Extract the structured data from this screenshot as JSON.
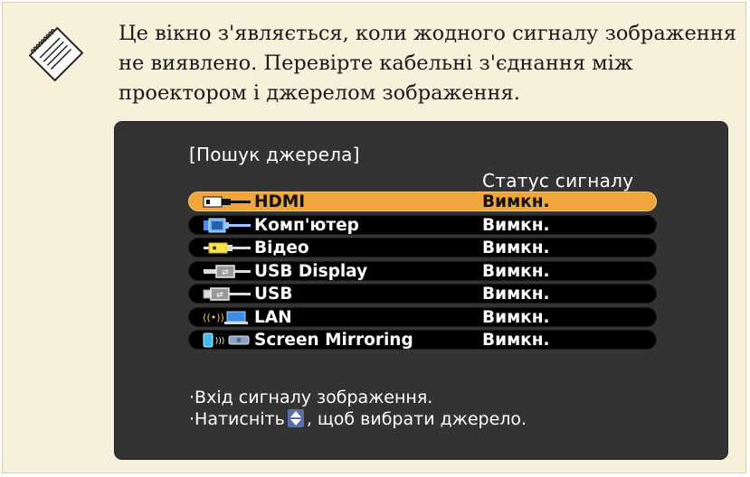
{
  "note": {
    "icon": "memo-pencil-icon",
    "lines": [
      "Це вікно з'являється, коли жодного сигналу зображення",
      "не виявлено. Перевірте кабельні з'єднання між",
      "проектором і джерелом зображення."
    ]
  },
  "screen": {
    "title": "[Пошук джерела]",
    "status_header": "Статус сигналу",
    "sources": [
      {
        "label": "HDMI",
        "status": "Вимкн.",
        "icon": "hdmi-icon",
        "selected": true
      },
      {
        "label": "Комп'ютер",
        "status": "Вимкн.",
        "icon": "computer-icon",
        "selected": false
      },
      {
        "label": "Відео",
        "status": "Вимкн.",
        "icon": "video-icon",
        "selected": false
      },
      {
        "label": "USB Display",
        "status": "Вимкн.",
        "icon": "usb-display-icon",
        "selected": false
      },
      {
        "label": "USB",
        "status": "Вимкн.",
        "icon": "usb-icon",
        "selected": false
      },
      {
        "label": "LAN",
        "status": "Вимкн.",
        "icon": "lan-icon",
        "selected": false
      },
      {
        "label": "Screen Mirroring",
        "status": "Вимкн.",
        "icon": "screen-mirroring-icon",
        "selected": false
      }
    ],
    "hint1": "·Вхід сигналу зображення.",
    "hint2_prefix": "·Натисніть",
    "hint2_suffix": ", щоб вибрати джерело."
  },
  "colors": {
    "note_background": "#f7f1dc",
    "screen_background": "#333333",
    "selected_row": "#f0a63a",
    "row_background": "#000000"
  }
}
